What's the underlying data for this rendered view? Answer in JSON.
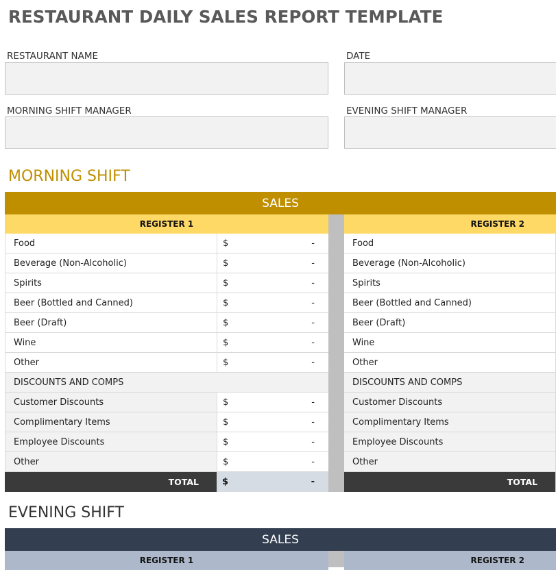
{
  "title": "RESTAURANT DAILY SALES REPORT TEMPLATE",
  "fields": {
    "restaurant_name": "RESTAURANT NAME",
    "date": "DATE",
    "morning_manager": "MORNING SHIFT MANAGER",
    "evening_manager": "EVENING SHIFT MANAGER"
  },
  "colors": {
    "morning_band": "#bf8f00",
    "morning_register": "#ffd966",
    "evening_band": "#333f50",
    "evening_register": "#adb9ca",
    "total_bg": "#3a3a3a"
  },
  "morning": {
    "heading": "MORNING SHIFT",
    "band": "SALES",
    "register1": "REGISTER 1",
    "register2": "REGISTER 2",
    "rows": [
      {
        "label": "Food",
        "currency": "$",
        "value": "-"
      },
      {
        "label": "Beverage (Non-Alcoholic)",
        "currency": "$",
        "value": "-"
      },
      {
        "label": "Spirits",
        "currency": "$",
        "value": "-"
      },
      {
        "label": "Beer (Bottled and Canned)",
        "currency": "$",
        "value": "-"
      },
      {
        "label": "Beer (Draft)",
        "currency": "$",
        "value": "-"
      },
      {
        "label": "Wine",
        "currency": "$",
        "value": "-"
      },
      {
        "label": "Other",
        "currency": "$",
        "value": "-"
      }
    ],
    "discounts_heading": "DISCOUNTS AND COMPS",
    "discounts": [
      {
        "label": "Customer Discounts",
        "currency": "$",
        "value": "-"
      },
      {
        "label": "Complimentary Items",
        "currency": "$",
        "value": "-"
      },
      {
        "label": "Employee Discounts",
        "currency": "$",
        "value": "-"
      },
      {
        "label": "Other",
        "currency": "$",
        "value": "-"
      }
    ],
    "total_label": "TOTAL",
    "total_currency": "$",
    "total_value": "-"
  },
  "evening": {
    "heading": "EVENING SHIFT",
    "band": "SALES",
    "register1": "REGISTER 1",
    "register2": "REGISTER 2"
  }
}
